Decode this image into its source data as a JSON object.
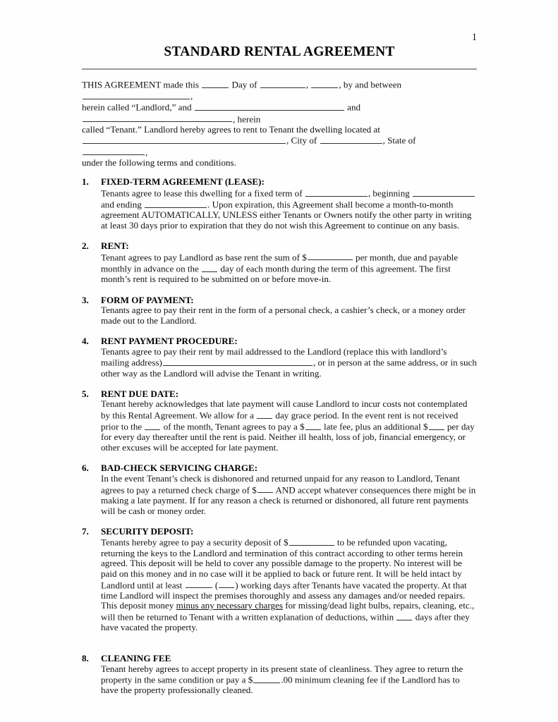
{
  "page": {
    "number": "1",
    "title": "STANDARD RENTAL AGREEMENT"
  },
  "intro": {
    "line1_a": "THIS AGREEMENT made this ",
    "line1_b": " Day of ",
    "line1_c": ", ",
    "line1_d": ", by and between ",
    "line1_e": ",",
    "line2_a": "herein called “Landlord,” and ",
    "line2_b": " and ",
    "line2_c": ", herein",
    "line3": "called “Tenant.” Landlord hereby agrees to rent to Tenant the dwelling located at",
    "line4_a": ", City of ",
    "line4_b": ", State of ",
    "line4_c": ",",
    "line5": "under the following terms and conditions."
  },
  "sections": [
    {
      "number": "1.",
      "heading": "FIXED-TERM AGREEMENT (LEASE):",
      "body_a": "Tenants agree to lease this dwelling for a fixed term of ",
      "body_b": ", beginning ",
      "body_c": " and ending ",
      "body_d": ". Upon expiration, this Agreement shall become a month-to-month agreement AUTOMATICALLY, UNLESS either Tenants or Owners notify the other party in writing at least 30 days prior to expiration that they do not wish this Agreement to continue on any basis."
    },
    {
      "number": "2.",
      "heading": "RENT:",
      "body_a": "Tenant agrees to pay Landlord as base rent the sum of $",
      "body_b": " per month, due and payable monthly in advance on the ",
      "body_c": " day of each month during the term of this agreement. The first month’s rent is required to be submitted on or before move-in."
    },
    {
      "number": "3.",
      "heading": "FORM OF PAYMENT:",
      "body_a": "Tenants agree to pay their rent in the form of a personal check, a cashier’s check, or a money order made out to the Landlord."
    },
    {
      "number": "4.",
      "heading": "RENT PAYMENT PROCEDURE:",
      "body_a": "Tenants agree to pay their rent by mail addressed to the Landlord (replace this with landlord’s mailing address)",
      "body_b": ", or in person at the same address, or in such other way as the Landlord will advise the Tenant in writing."
    },
    {
      "number": "5.",
      "heading": "RENT DUE DATE:",
      "body_a": "Tenant hereby acknowledges that late payment will cause Landlord to incur costs not contemplated by this Rental Agreement. We allow for a ",
      "body_b": " day grace period. In the event rent is not received prior to the ",
      "body_c": " of the month, Tenant agrees to pay a $",
      "body_d": " late fee, plus an additional $",
      "body_e": " per day for every day thereafter until the rent is paid. Neither ill health, loss of job, financial emergency, or other excuses will be accepted for late payment."
    },
    {
      "number": "6.",
      "heading": "BAD-CHECK SERVICING CHARGE:",
      "body_a": "In the event Tenant’s check is dishonored and returned unpaid for any reason to Landlord, Tenant agrees to pay a returned check charge of $",
      "body_b": " AND accept whatever consequences there might be in making a late payment. If for any reason a check is returned or dishonored, all future rent payments will be cash or money order."
    },
    {
      "number": "7.",
      "heading": "SECURITY DEPOSIT:",
      "body_a": "Tenants hereby agree to pay a security deposit of $",
      "body_b": " to be refunded upon vacating, returning the keys to the Landlord and termination of this contract according to other terms herein agreed.  This deposit will be held to cover any possible damage to the property. No interest will be paid on this money and in no case will it be applied to back or future rent. It will be held intact by Landlord until at least ",
      "body_c": " (",
      "body_d": ") working days after Tenants have vacated the property. At that time Landlord will inspect the premises thoroughly and assess any damages and/or needed repairs. This deposit money ",
      "body_underlined": "minus any necessary charges",
      "body_e": " for missing/dead light bulbs, repairs, cleaning, etc., will then be returned to Tenant with a written explanation of deductions, within ",
      "body_f": " days after they have vacated the property."
    },
    {
      "number": "8.",
      "heading": "CLEANING FEE",
      "body_a": "Tenant hereby agrees to accept property in its present state of cleanliness. They agree to return the property in the same condition or pay a $",
      "body_b": ".00 minimum cleaning fee if the Landlord has to have the property professionally cleaned."
    }
  ]
}
